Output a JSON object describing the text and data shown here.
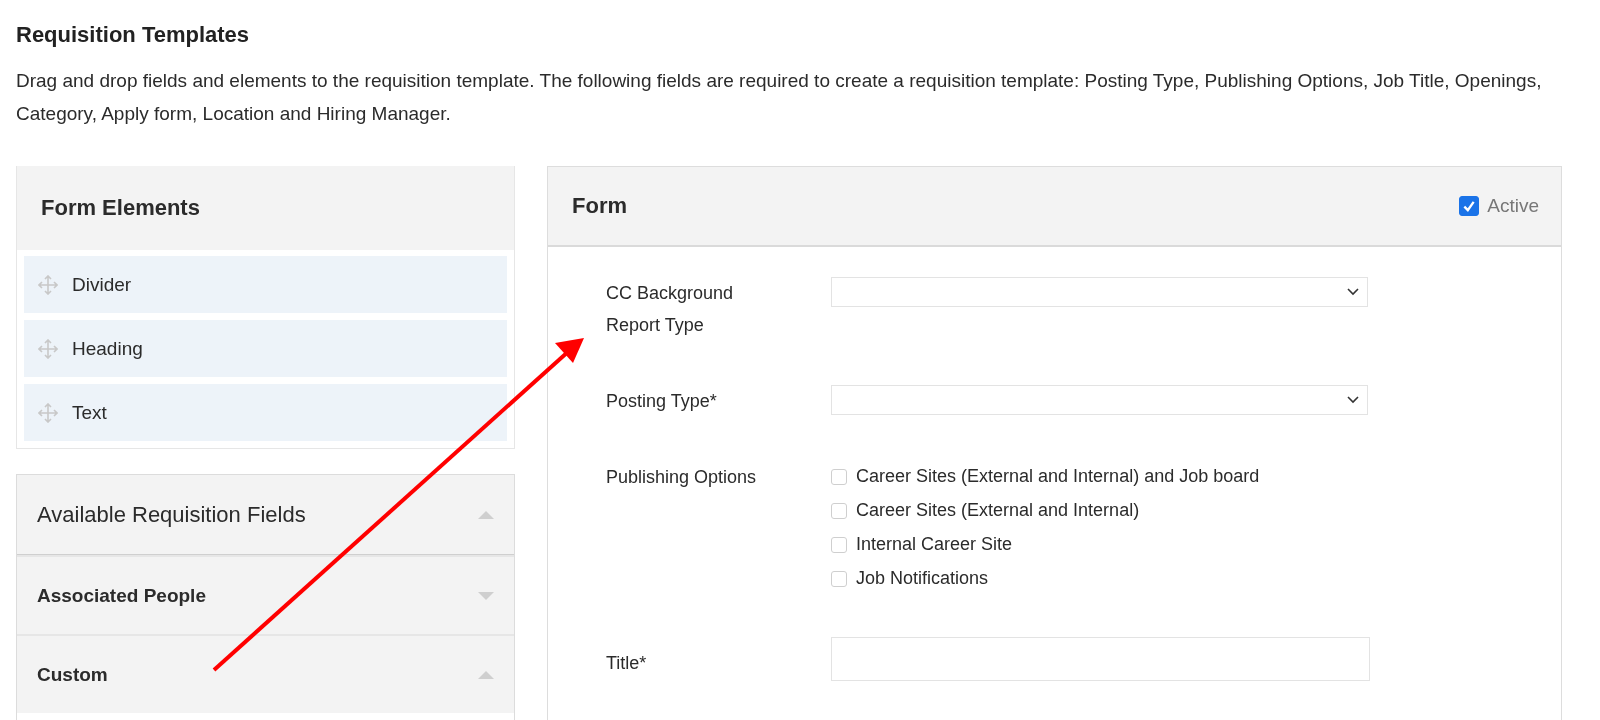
{
  "page_title": "Requisition Templates",
  "description": "Drag and drop fields and elements to the requisition template. The following fields are required to create a requisition template: Posting Type, Publishing Options, Job Title, Openings, Category, Apply form, Location and Hiring Manager.",
  "form_elements": {
    "title": "Form Elements",
    "items": [
      "Divider",
      "Heading",
      "Text"
    ]
  },
  "available_fields": {
    "title": "Available Requisition Fields",
    "expanded": true,
    "groups": [
      {
        "title": "Associated People",
        "expanded": false
      },
      {
        "title": "Custom",
        "expanded": true
      }
    ]
  },
  "form": {
    "title": "Form",
    "active": {
      "label": "Active",
      "checked": true
    },
    "fields": [
      {
        "kind": "select",
        "label": "CC Background Report Type"
      },
      {
        "kind": "select",
        "label": "Posting Type*"
      },
      {
        "kind": "checkboxes",
        "label": "Publishing Options",
        "options": [
          {
            "label": "Career Sites (External and Internal) and Job board",
            "checked": false
          },
          {
            "label": "Career Sites (External and Internal)",
            "checked": false
          },
          {
            "label": "Internal Career Site",
            "checked": false
          },
          {
            "label": "Job Notifications",
            "checked": false
          }
        ]
      },
      {
        "kind": "text",
        "label": "Title*"
      }
    ]
  }
}
